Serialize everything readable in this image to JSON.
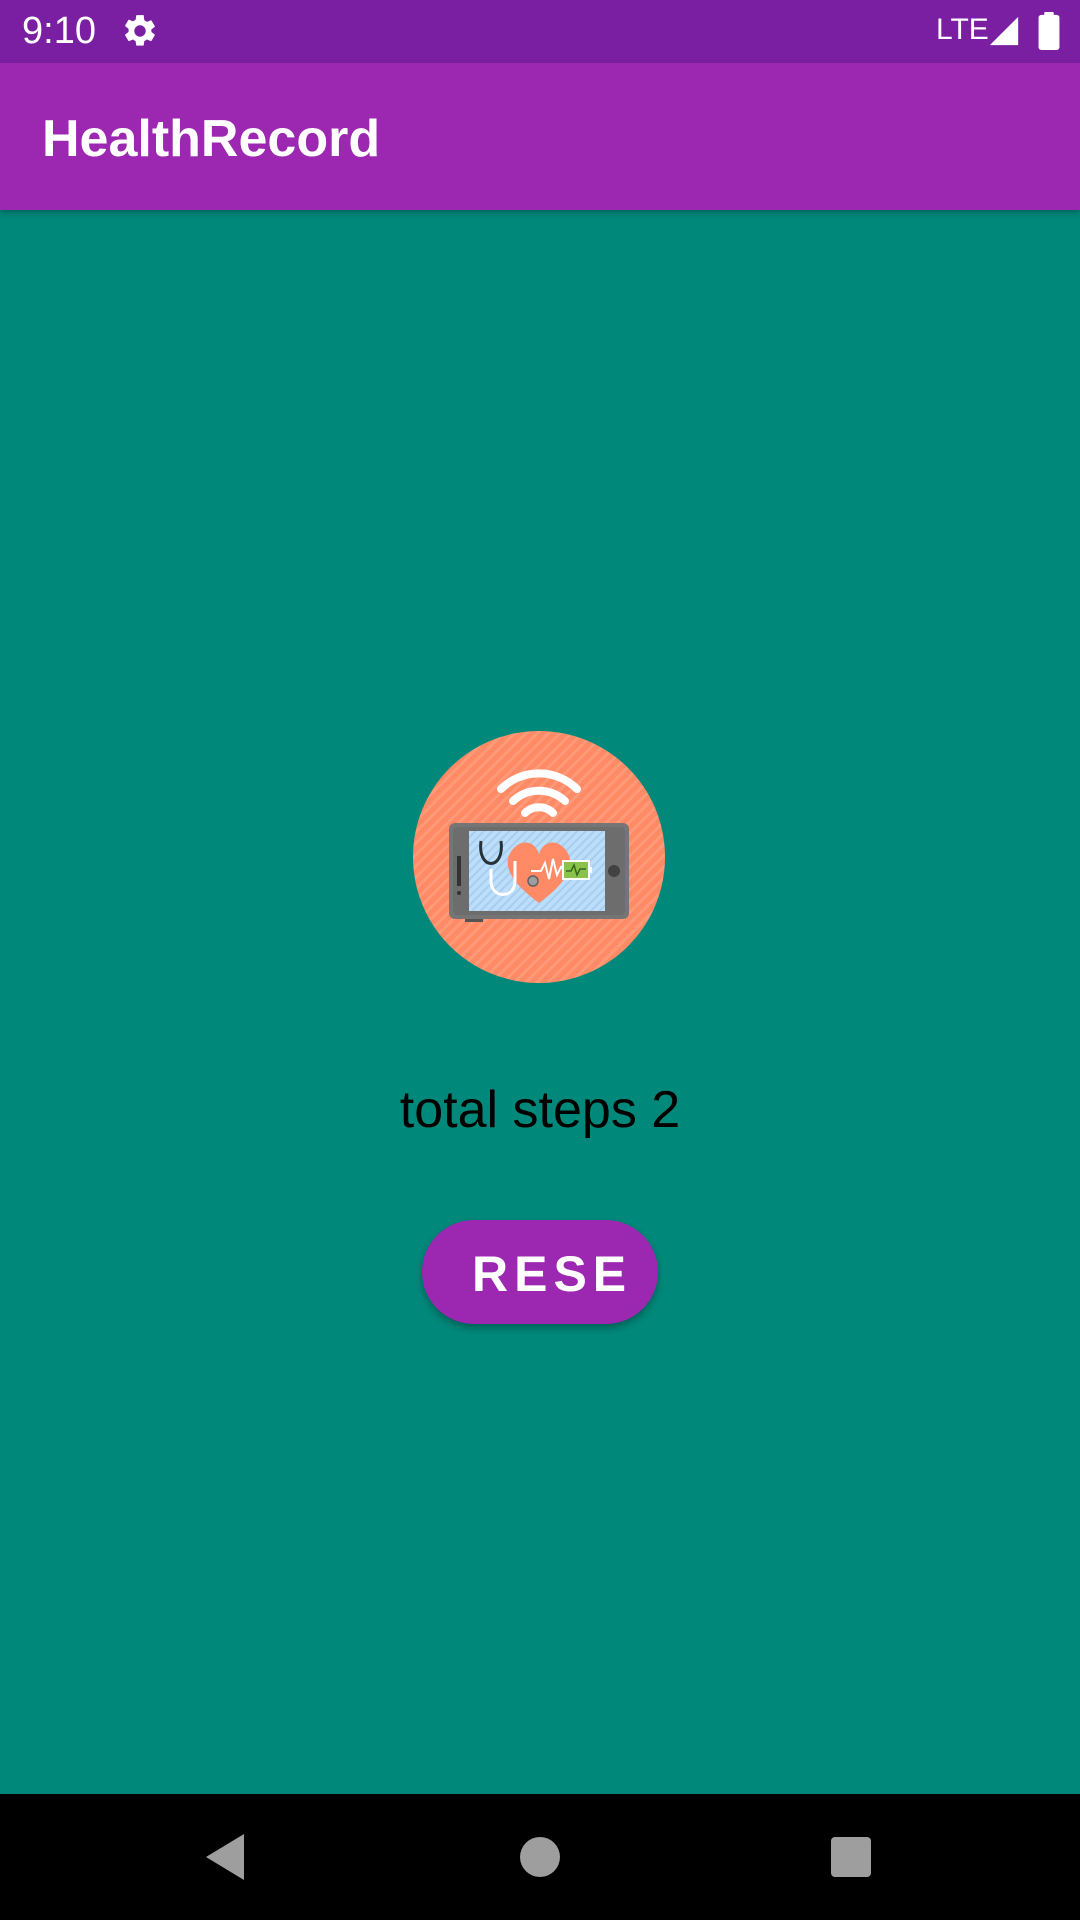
{
  "status_bar": {
    "time": "9:10",
    "network": "LTE",
    "icons": [
      "gear-icon",
      "signal-icon",
      "battery-icon"
    ]
  },
  "app_bar": {
    "title": "HealthRecord"
  },
  "main": {
    "logo_icon": "health-monitor-phone-icon",
    "steps_text": "total steps 2",
    "reset_button_label": "RESE"
  },
  "nav_bar": {
    "icons": [
      "back-icon",
      "home-icon",
      "recents-icon"
    ]
  },
  "colors": {
    "status_bar": "#7b1fa2",
    "app_bar": "#9c27b0",
    "background": "#00897b",
    "button": "#9c27b0",
    "logo_circle": "#ff8a65"
  }
}
